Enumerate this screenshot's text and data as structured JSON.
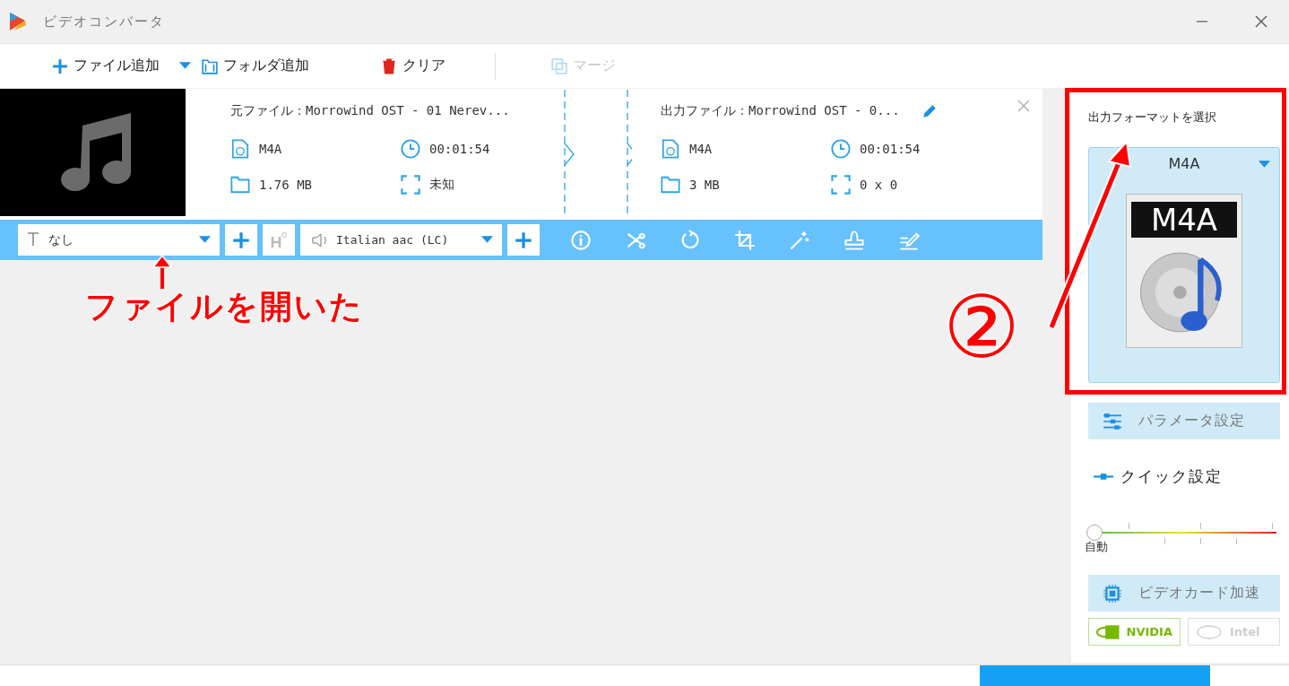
{
  "window": {
    "title": "ビデオコンバータ"
  },
  "toolbar": [
    {
      "kind": "add-file",
      "label": "ファイル追加",
      "disabled": false
    },
    {
      "kind": "add-folder",
      "label": "フォルダ追加",
      "disabled": false
    },
    {
      "kind": "clear",
      "label": "クリア",
      "disabled": false
    },
    {
      "kind": "merge",
      "label": "マージ",
      "disabled": true
    }
  ],
  "file": {
    "source": {
      "label": "元ファイル：",
      "name": "Morrowind OST - 01 Nerev...",
      "format": "M4A",
      "duration": "00:01:54",
      "size": "1.76 MB",
      "resolution": "未知"
    },
    "output": {
      "label": "出力ファイル：",
      "name": "Morrowind OST - 0...",
      "format": "M4A",
      "duration": "00:01:54",
      "size": "3 MB",
      "resolution": "0 x 0"
    },
    "subtitle": "なし",
    "audio": "Italian aac (LC)"
  },
  "format_panel": {
    "heading": "出力フォーマットを選択",
    "format": "M4A",
    "icon_label": "M4A",
    "params_button": "パラメータ設定",
    "quick_label": "クイック設定",
    "quality": {
      "level": 0,
      "reading": "自動"
    },
    "gpu_label": "ビデオカード加速",
    "gpus": [
      {
        "kind": "nvidia",
        "label": "NVIDIA",
        "selected": true
      },
      {
        "kind": "intel",
        "label": "Intel",
        "selected": false
      }
    ]
  },
  "annotations": {
    "caption": "ファイルを開いた",
    "step": "②"
  }
}
